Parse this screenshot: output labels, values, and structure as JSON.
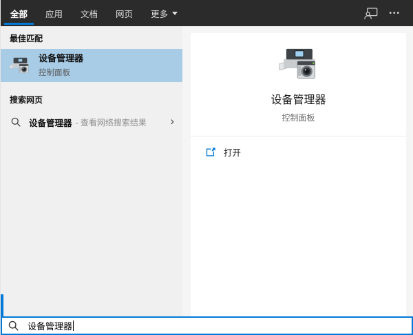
{
  "header": {
    "tabs": [
      {
        "label": "全部",
        "active": true
      },
      {
        "label": "应用",
        "active": false
      },
      {
        "label": "文档",
        "active": false
      },
      {
        "label": "网页",
        "active": false
      },
      {
        "label": "更多",
        "active": false,
        "has_dropdown": true
      }
    ],
    "ellipsis_glyph": "•••"
  },
  "best_match": {
    "section_label": "最佳匹配",
    "item": {
      "title": "设备管理器",
      "subtitle": "控制面板"
    }
  },
  "web_search": {
    "section_label": "搜索网页",
    "item": {
      "query": "设备管理器",
      "hint": "- 查看网络搜索结果",
      "chevron_glyph": "›"
    }
  },
  "preview": {
    "title": "设备管理器",
    "subtitle": "控制面板",
    "open_label": "打开"
  },
  "search_box": {
    "value": "设备管理器"
  },
  "colors": {
    "accent": "#0078d7",
    "highlight": "#a8cce6",
    "header_bg": "#2b2b2b",
    "left_panel_bg": "#f0f0f0",
    "gutter_bg": "#f5f5f6"
  }
}
